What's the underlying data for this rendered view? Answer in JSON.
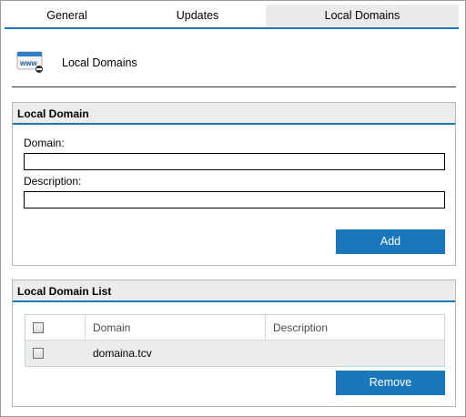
{
  "tabs": [
    {
      "label": "General"
    },
    {
      "label": "Updates"
    },
    {
      "label": "Local Domains",
      "active": true
    }
  ],
  "header": {
    "title": "Local Domains",
    "icon": "www-globe-icon"
  },
  "local_domain": {
    "title": "Local Domain",
    "domain_label": "Domain:",
    "domain_value": "",
    "description_label": "Description:",
    "description_value": "",
    "add_label": "Add"
  },
  "domain_list": {
    "title": "Local Domain List",
    "columns": [
      "Domain",
      "Description"
    ],
    "rows": [
      {
        "domain": "domaina.tcv",
        "description": "",
        "checked": false
      }
    ],
    "remove_label": "Remove"
  },
  "colors": {
    "accent": "#1a77bc",
    "panel_header": "#ececec"
  }
}
